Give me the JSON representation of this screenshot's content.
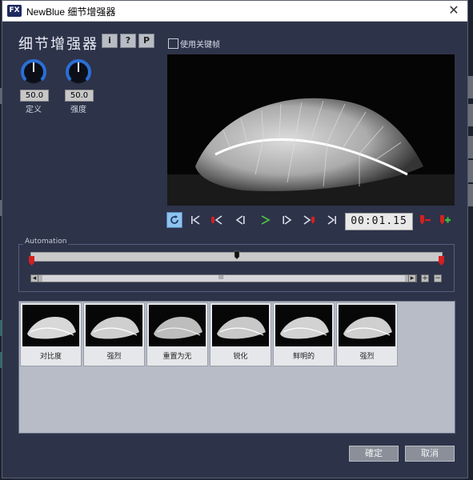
{
  "window": {
    "title": "NewBlue 细节增强器",
    "app_icon_text": "FX",
    "close_glyph": "✕"
  },
  "plugin": {
    "heading": "细节增强器",
    "buttons": [
      "i",
      "?",
      "P"
    ]
  },
  "knobs": [
    {
      "value": "50.0",
      "label": "定义"
    },
    {
      "value": "50.0",
      "label": "强度"
    }
  ],
  "keyframes": {
    "label": "使用关键帧",
    "checked": false
  },
  "transport": {
    "timecode": "00:01.15",
    "icons": [
      "loop-icon",
      "go-start-icon",
      "prev-keyframe-icon",
      "step-back-icon",
      "play-icon",
      "step-forward-icon",
      "next-keyframe-icon",
      "go-end-icon",
      "remove-keyframe-icon",
      "add-keyframe-icon"
    ]
  },
  "automation": {
    "label": "Automation",
    "scroll_thumb_glyph": "III",
    "left_arrow": "◂",
    "right_arrow": "▸",
    "plus": "+",
    "minus": "−"
  },
  "presets": [
    {
      "label": "对比度"
    },
    {
      "label": "强烈"
    },
    {
      "label": "重置为无"
    },
    {
      "label": "锐化"
    },
    {
      "label": "鲜明的"
    },
    {
      "label": "强烈"
    }
  ],
  "dialog": {
    "ok_label": "確定",
    "cancel_label": "取消"
  },
  "colors": {
    "panel": "#2d3349",
    "accent_blue": "#2a6fd6",
    "keyframe_red": "#d42020",
    "play_green": "#48c040",
    "add_green": "#3cbf3c"
  }
}
